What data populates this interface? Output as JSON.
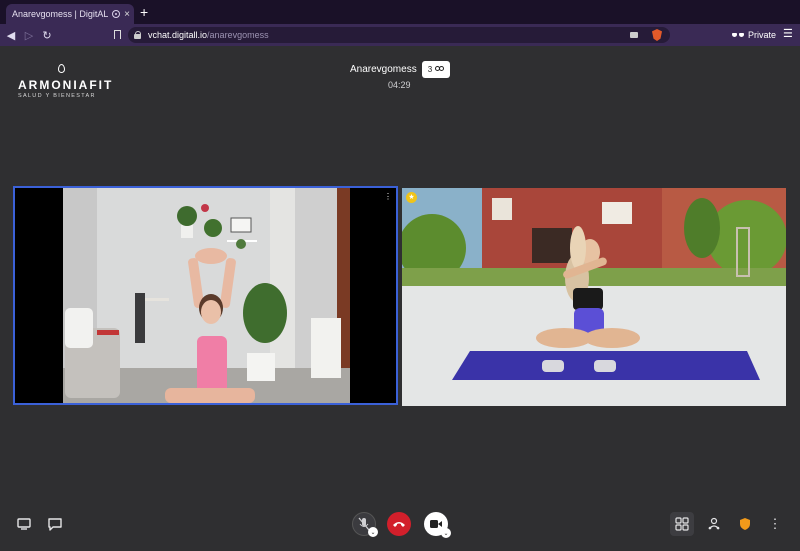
{
  "browser": {
    "tab_title": "Anarevgomess | DigitALL Pl",
    "tab_close": "×",
    "new_tab": "+",
    "url_host": "vchat.digitall.io",
    "url_path": "/anarevgomess",
    "private_label": "Private",
    "back_glyph": "◀",
    "forward_glyph": "▷",
    "reload_glyph": "↻",
    "menu_glyph": "☰"
  },
  "logo": {
    "name": "ARMONIAFIT",
    "tagline": "SALUD Y BIENESTAR"
  },
  "room": {
    "title": "Anarevgomess",
    "participant_count": "3",
    "timer": "04:29"
  },
  "tiles": {
    "tile_a_menu": "⋮",
    "tile_b_badge": "★"
  },
  "toolbar": {
    "more_glyph": "⋮",
    "caret_glyph": "⌄"
  },
  "icons": [
    "screen-share-icon",
    "chat-icon",
    "mic-muted-icon",
    "hangup-icon",
    "camera-icon",
    "grid-view-icon",
    "participants-icon",
    "security-shield-icon",
    "more-options-icon"
  ],
  "colors": {
    "hangup": "#d21f2b",
    "shield": "#f19a1a",
    "active_speaker_border": "#3b61d8",
    "browser_chrome": "#3a2a55"
  }
}
